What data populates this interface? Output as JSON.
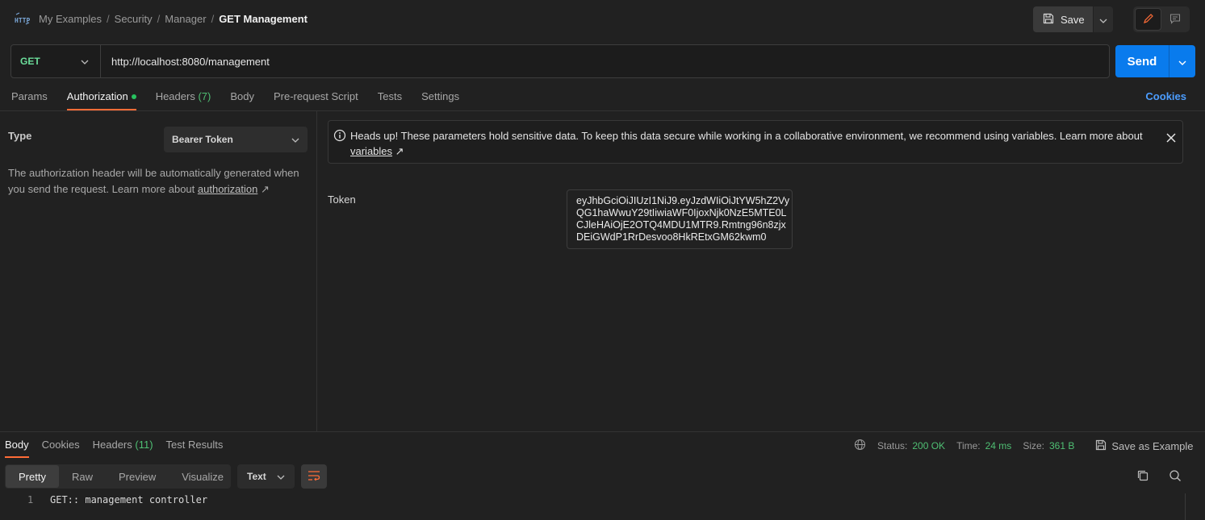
{
  "breadcrumb": {
    "items": [
      "My Examples",
      "Security",
      "Manager"
    ],
    "separator": "/",
    "current": "GET Management"
  },
  "toolbar": {
    "save_label": "Save"
  },
  "request": {
    "method": "GET",
    "url": "http://localhost:8080/management",
    "send_label": "Send"
  },
  "tabs": {
    "params": "Params",
    "authorization": "Authorization",
    "headers": "Headers",
    "headers_count": "(7)",
    "body": "Body",
    "prerequest": "Pre-request Script",
    "tests": "Tests",
    "settings": "Settings",
    "cookies": "Cookies"
  },
  "auth": {
    "type_label": "Type",
    "type_value": "Bearer Token",
    "description": "The authorization header will be automatically generated when you send the request. Learn more about ",
    "description_link": "authorization",
    "arrow": "↗",
    "alert_text": "Heads up! These parameters hold sensitive data. To keep this data secure while working in a collaborative environment, we recommend using variables. Learn more about ",
    "alert_link": "variables",
    "token_label": "Token",
    "token_value": "eyJhbGciOiJIUzI1NiJ9.eyJzdWIiOiJtYW5hZ2VyQG1haWwuY29tIiwiaWF0IjoxNjk0NzE5MTE0LCJleHAiOjE2OTQ4MDU1MTR9.Rmtng96n8zjxDEiGWdP1RrDesvoo8HkREtxGM62kwm0"
  },
  "response": {
    "tabs": {
      "body": "Body",
      "cookies": "Cookies",
      "headers": "Headers",
      "headers_count": "(11)",
      "test_results": "Test Results"
    },
    "status_label": "Status:",
    "status_value": "200 OK",
    "time_label": "Time:",
    "time_value": "24 ms",
    "size_label": "Size:",
    "size_value": "361 B",
    "save_example": "Save as Example",
    "more": "•••",
    "views": [
      "Pretty",
      "Raw",
      "Preview",
      "Visualize"
    ],
    "format": "Text",
    "line_number": "1",
    "body_text": "GET:: management controller"
  },
  "colors": {
    "accent": "#ff6c37",
    "send": "#097bed",
    "method_get": "#6bdd9a",
    "status_ok": "#4fbf73",
    "link": "#4c9dff"
  },
  "icons": [
    "http-icon",
    "save-icon",
    "chevron-down-icon",
    "pencil-icon",
    "comment-icon",
    "info-icon",
    "close-icon",
    "globe-icon",
    "wrap-lines-icon",
    "copy-icon",
    "search-icon"
  ]
}
